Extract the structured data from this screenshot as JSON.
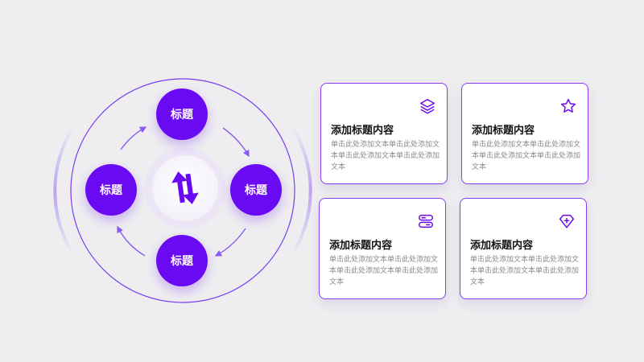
{
  "diagram": {
    "nodes": {
      "top": "标题",
      "right": "标题",
      "bottom": "标题",
      "left": "标题"
    },
    "center_icon": "refresh-arrows-icon"
  },
  "cards": [
    {
      "icon": "layers-icon",
      "title": "添加标题内容",
      "body": "单击此处添加文本单击此处添加文本单击此处添加文本单击此处添加文本"
    },
    {
      "icon": "star-icon",
      "title": "添加标题内容",
      "body": "单击此处添加文本单击此处添加文本单击此处添加文本单击此处添加文本"
    },
    {
      "icon": "server-icon",
      "title": "添加标题内容",
      "body": "单击此处添加文本单击此处添加文本单击此处添加文本单击此处添加文本"
    },
    {
      "icon": "diamond-plus-icon",
      "title": "添加标题内容",
      "body": "单击此处添加文本单击此处添加文本单击此处添加文本单击此处添加文本"
    }
  ],
  "colors": {
    "accent": "#6a0af2",
    "background": "#eeeef0",
    "ring_light": "#e2daf3"
  }
}
